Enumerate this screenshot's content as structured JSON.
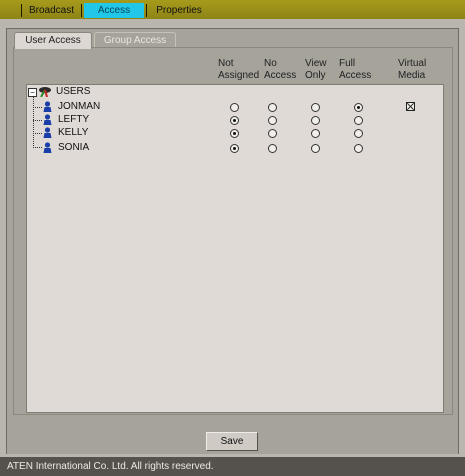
{
  "nav": {
    "tabs": [
      {
        "label": "Broadcast"
      },
      {
        "label": "Access",
        "active": true
      },
      {
        "label": "Properties"
      }
    ]
  },
  "subtabs": [
    {
      "label": "User Access",
      "active": true
    },
    {
      "label": "Group Access",
      "active": false
    }
  ],
  "columns": {
    "not_assigned": [
      "Not",
      "Assigned"
    ],
    "no_access": [
      "No",
      "Access"
    ],
    "view_only": [
      "View",
      "Only"
    ],
    "full_access": [
      "Full",
      "Access"
    ],
    "virtual_media": [
      "Virtual",
      "Media"
    ]
  },
  "tree": {
    "root": "USERS",
    "users": [
      {
        "name": "JONMAN",
        "access": "full_access",
        "virtual_media": true
      },
      {
        "name": "LEFTY",
        "access": "not_assigned",
        "virtual_media": false
      },
      {
        "name": "KELLY",
        "access": "not_assigned",
        "virtual_media": false
      },
      {
        "name": "SONIA",
        "access": "not_assigned",
        "virtual_media": false
      }
    ]
  },
  "buttons": {
    "save": "Save"
  },
  "footer": {
    "copyright": "ATEN International Co. Ltd. All rights reserved."
  },
  "colors": {
    "accent": "#21c7e8",
    "topbar": "#a79b1c",
    "footer": "#55524d"
  }
}
